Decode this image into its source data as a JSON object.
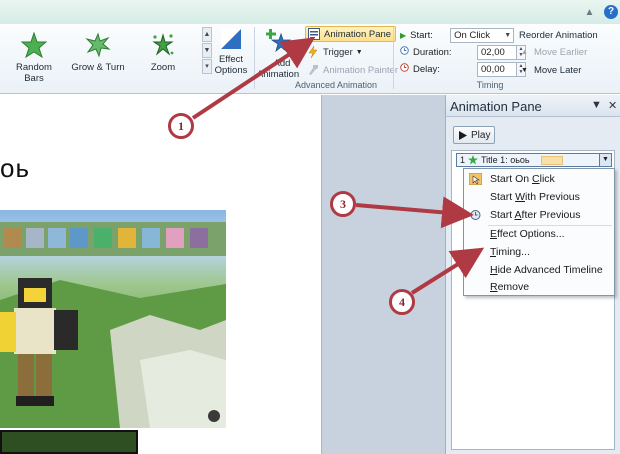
{
  "ribbon": {
    "gallery": [
      {
        "label": "Random Bars",
        "icon": "random-bars-star-icon"
      },
      {
        "label": "Grow & Turn",
        "icon": "grow-turn-star-icon"
      },
      {
        "label": "Zoom",
        "icon": "zoom-star-icon"
      }
    ],
    "effect_options_line1": "Effect",
    "effect_options_line2": "Options",
    "add_animation_line1": "Add",
    "add_animation_line2": "Animation",
    "animation_pane": "Animation Pane",
    "trigger": "Trigger",
    "animation_painter": "Animation Painter",
    "group_advanced": "Advanced Animation",
    "start_label": "Start:",
    "start_value": "On Click",
    "duration_label": "Duration:",
    "duration_value": "02,00",
    "delay_label": "Delay:",
    "delay_value": "00,00",
    "reorder_title": "Reorder Animation",
    "move_earlier": "Move Earlier",
    "move_later": "Move Later",
    "group_timing": "Timing",
    "help": "?"
  },
  "slide": {
    "title_fragment": "оь"
  },
  "pane": {
    "title": "Animation Pane",
    "play": "Play",
    "item_number": "1",
    "item_label": "Title 1: оьоь"
  },
  "menu": {
    "items": [
      {
        "pre": "Start On ",
        "key": "C",
        "post": "lick"
      },
      {
        "pre": "Start ",
        "key": "W",
        "post": "ith Previous"
      },
      {
        "pre": "Start ",
        "key": "A",
        "post": "fter Previous"
      },
      {
        "pre": "",
        "key": "E",
        "post": "ffect Options..."
      },
      {
        "pre": "",
        "key": "T",
        "post": "iming..."
      },
      {
        "pre": "",
        "key": "H",
        "post": "ide Advanced Timeline"
      },
      {
        "pre": "",
        "key": "R",
        "post": "emove"
      }
    ]
  },
  "callouts": [
    "1",
    "3",
    "4"
  ],
  "colors": {
    "callout": "#b03a44",
    "highlight": "#ffe08a"
  }
}
